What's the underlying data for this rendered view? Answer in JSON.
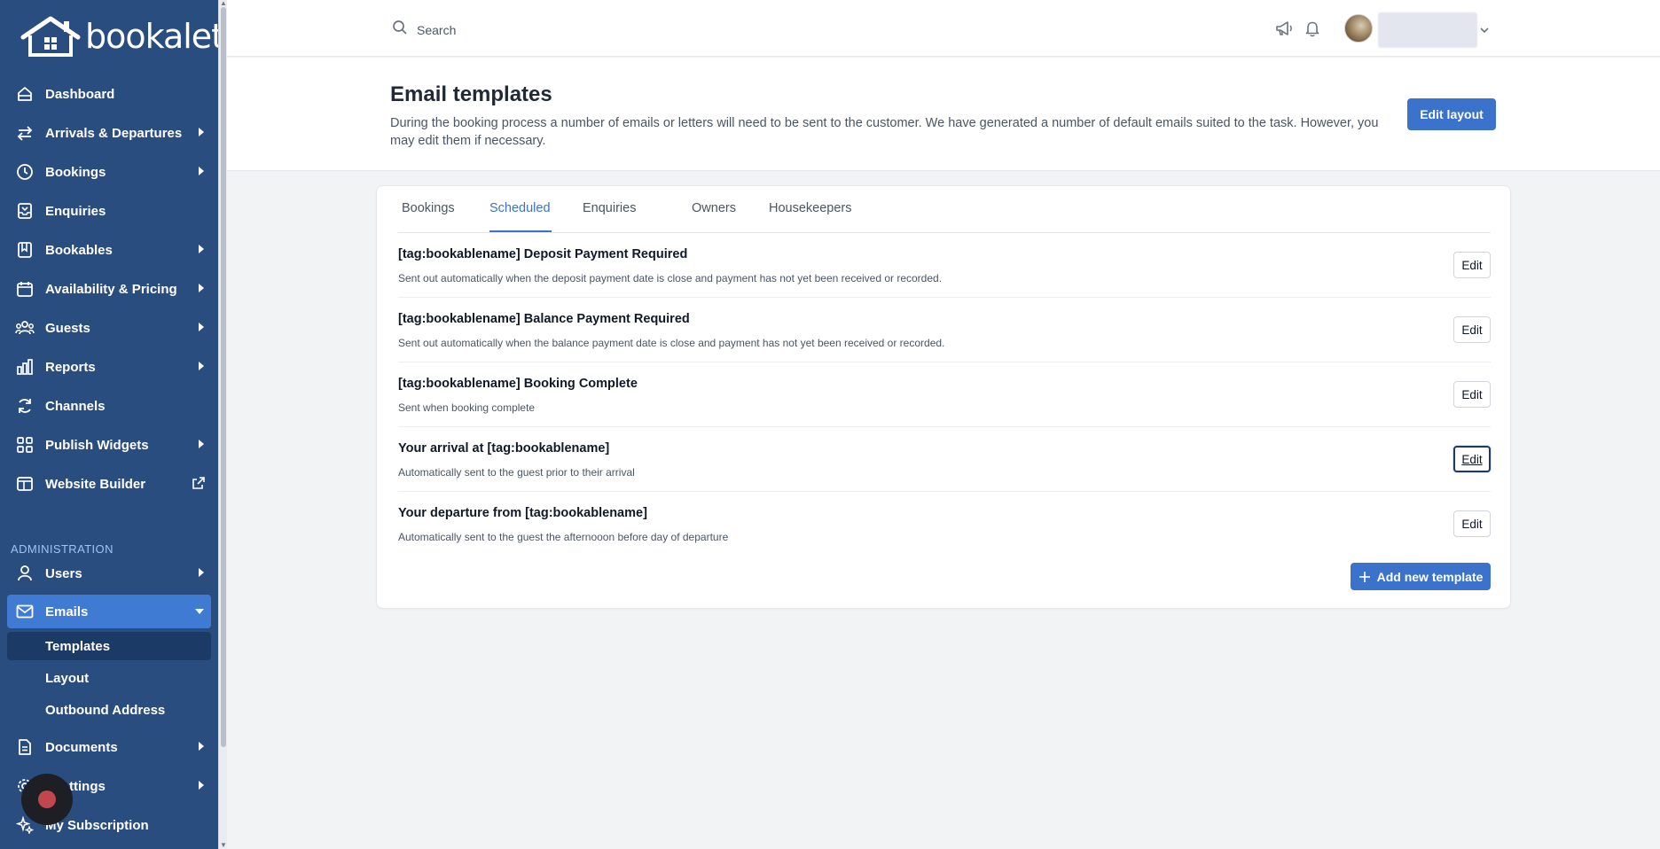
{
  "brand": {
    "name": "bookalet"
  },
  "sidebar": {
    "items": [
      {
        "label": "Dashboard",
        "icon": "home-icon"
      },
      {
        "label": "Arrivals & Departures",
        "icon": "swap-arrows-icon"
      },
      {
        "label": "Bookings",
        "icon": "clock-icon"
      },
      {
        "label": "Enquiries",
        "icon": "inbox-icon"
      },
      {
        "label": "Bookables",
        "icon": "book-icon"
      },
      {
        "label": "Availability & Pricing",
        "icon": "calendar-icon"
      },
      {
        "label": "Guests",
        "icon": "users-group-icon"
      },
      {
        "label": "Reports",
        "icon": "bar-chart-icon"
      },
      {
        "label": "Channels",
        "icon": "sync-icon"
      },
      {
        "label": "Publish Widgets",
        "icon": "grid-icon"
      },
      {
        "label": "Website Builder",
        "icon": "browser-icon"
      }
    ],
    "admin_label": "ADMINISTRATION",
    "admin_items": [
      {
        "label": "Users",
        "icon": "user-icon"
      },
      {
        "label": "Emails",
        "icon": "mail-icon"
      }
    ],
    "email_subitems": [
      {
        "label": "Templates"
      },
      {
        "label": "Layout"
      },
      {
        "label": "Outbound Address"
      }
    ],
    "bottom_items": [
      {
        "label": "Documents",
        "icon": "document-icon"
      },
      {
        "label": "ttings",
        "icon": "gear-icon"
      },
      {
        "label": "My Subscription",
        "icon": "sparkle-icon"
      }
    ]
  },
  "header": {
    "search_placeholder": "Search"
  },
  "page": {
    "title": "Email templates",
    "description": "During the booking process a number of emails or letters will need to be sent to the customer. We have generated a number of default emails suited to the task. However, you may edit them if necessary.",
    "edit_layout_label": "Edit layout"
  },
  "tabs": [
    {
      "label": "Bookings"
    },
    {
      "label": "Scheduled",
      "active": true
    },
    {
      "label": "Enquiries"
    },
    {
      "label": "Owners"
    },
    {
      "label": "Housekeepers"
    }
  ],
  "templates": [
    {
      "title": "[tag:bookablename] Deposit Payment Required",
      "description": "Sent out automatically when the deposit payment date is close and payment has not yet been received or recorded.",
      "edit_label": "Edit"
    },
    {
      "title": "[tag:bookablename] Balance Payment Required",
      "description": "Sent out automatically when the balance payment date is close and payment has not yet been received or recorded.",
      "edit_label": "Edit"
    },
    {
      "title": "[tag:bookablename] Booking Complete",
      "description": "Sent when booking complete",
      "edit_label": "Edit"
    },
    {
      "title": "Your arrival at [tag:bookablename]",
      "description": "Automatically sent to the guest prior to their arrival",
      "edit_label": "Edit"
    },
    {
      "title": "Your departure from [tag:bookablename]",
      "description": "Automatically sent to the guest the afternooon before day of departure",
      "edit_label": "Edit"
    }
  ],
  "add_template_label": "Add new template",
  "colors": {
    "sidebar": "#2a4d7f",
    "active": "#3f7bd3",
    "primary": "#3b73cc"
  }
}
